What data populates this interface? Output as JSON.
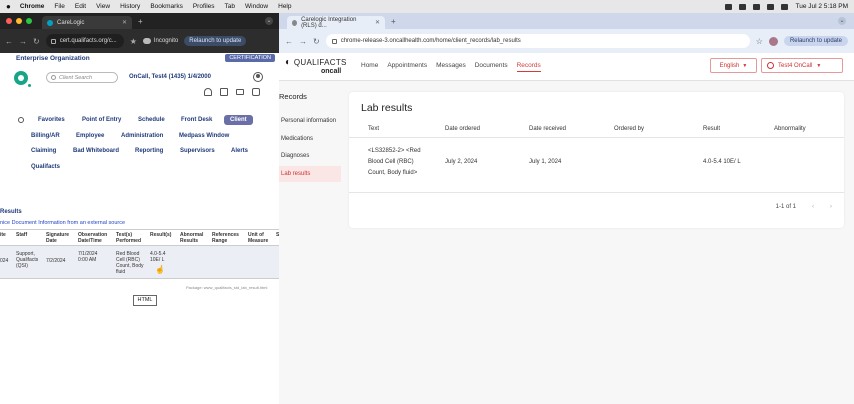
{
  "menubar": {
    "app": "Chrome",
    "items": [
      "File",
      "Edit",
      "View",
      "History",
      "Bookmarks",
      "Profiles",
      "Tab",
      "Window",
      "Help"
    ],
    "clock": "Tue Jul 2 5:18 PM"
  },
  "left_browser": {
    "tab_title": "CareLogic",
    "url": "cert.qualifacts.org/c...",
    "incognito_label": "Incognito",
    "relaunch_label": "Relaunch to update"
  },
  "carelogic": {
    "org": "Enterprise Organization",
    "cert_badge": "CERTIFICATION",
    "search_placeholder": "Client Search",
    "user": "OnCall, Test4 (1435) 1/4/2000",
    "menu_row1": [
      "Favorites",
      "Point of Entry",
      "Schedule",
      "Front Desk",
      "Client"
    ],
    "menu_row2": [
      "Billing/AR",
      "Employee",
      "Administration",
      "Medpass Window"
    ],
    "menu_row3": [
      "Claiming",
      "Bad Whiteboard",
      "Reporting",
      "Supervisors",
      "Alerts"
    ],
    "menu_row4": [
      "Qualifacts"
    ],
    "results_title": "Results",
    "results_link": "nice Document Information from an external source",
    "table_headers": [
      "ite",
      "Staff",
      "Signature Date",
      "Observation Date/Time",
      "Test(s) Performed",
      "Result(s)",
      "Abnormal Results",
      "References Range",
      "Unit of Measure",
      "S"
    ],
    "row": {
      "date": "024",
      "staff": "Support, Qualifacts (QSI)",
      "sig_date": "7/2/2024",
      "obs_date": "7/1/2024 0:00 AM",
      "test": "Red Blood Cell (RBC) Count, Body fluid",
      "result": "4.0-5.4 10E/ L"
    },
    "footer_note": "Package: www_qualifacts_std_lab_result.html",
    "html_button": "HTML"
  },
  "right_browser": {
    "tab_title": "Carelogic Integration (RLS) d...",
    "url": "chrome-release-3.oncallhealth.com/home/client_records/lab_results",
    "relaunch_label": "Relaunch to update"
  },
  "qualifacts": {
    "brand": "QUALIFACTS",
    "brand_sub": "oncall",
    "nav": [
      "Home",
      "Appointments",
      "Messages",
      "Documents",
      "Records"
    ],
    "active_nav": "Records",
    "language": "English",
    "user": "Test4 OnCall",
    "sidebar_title": "Records",
    "sidebar": [
      "Personal information",
      "Medications",
      "Diagnoses",
      "Lab results"
    ],
    "active_sidebar": "Lab results",
    "page_title": "Lab results",
    "columns": [
      "Text",
      "Date ordered",
      "Date received",
      "Ordered by",
      "Result",
      "Abnormality"
    ],
    "row": {
      "text_lines": [
        "<LS32852-2> <Red",
        "Blood Cell (RBC)",
        "Count, Body fluid>"
      ],
      "date_ordered": "July 2, 2024",
      "date_received": "July 1, 2024",
      "ordered_by": "",
      "result": "4.0-5.4 10E/ L",
      "abnormality": ""
    },
    "pagination": "1-1 of 1",
    "prev": "‹",
    "next": "›"
  }
}
